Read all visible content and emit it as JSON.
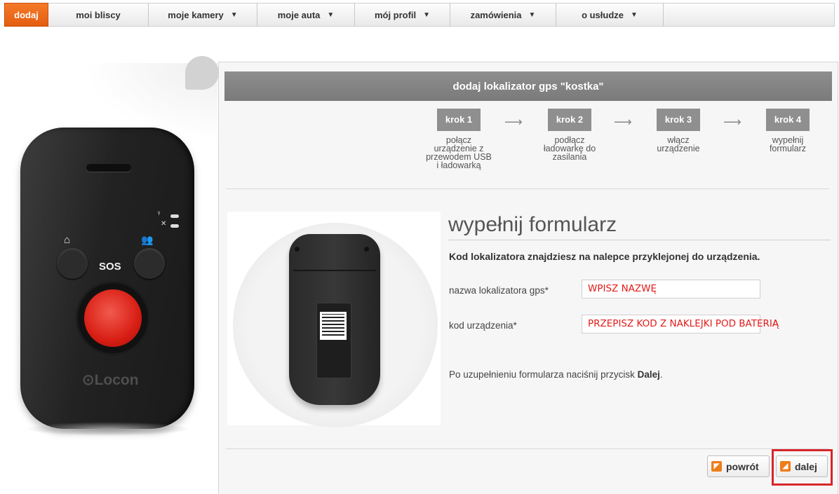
{
  "nav": {
    "items": [
      {
        "label": "dodaj",
        "active": true
      },
      {
        "label": "moi bliscy",
        "has_dropdown": false
      },
      {
        "label": "moje kamery",
        "has_dropdown": true
      },
      {
        "label": "moje auta",
        "has_dropdown": true
      },
      {
        "label": "mój profil",
        "has_dropdown": true
      },
      {
        "label": "zamówienia",
        "has_dropdown": true
      },
      {
        "label": "o usłudze",
        "has_dropdown": true
      }
    ],
    "active_color": "#ec6a1c"
  },
  "device": {
    "sos_label": "SOS",
    "brand": "⊙Locon",
    "button_color": "#d81e14"
  },
  "panel": {
    "title": "dodaj lokalizator gps \"kostka\"",
    "steps": [
      {
        "badge": "krok 1",
        "desc": [
          "połącz",
          "urządzenie z",
          "przewodem USB",
          "i ładowarką"
        ]
      },
      {
        "badge": "krok 2",
        "desc": [
          "podłącz",
          "ładowarkę do",
          "zasilania"
        ]
      },
      {
        "badge": "krok 3",
        "desc": [
          "włącz",
          "urządzenie"
        ]
      },
      {
        "badge": "krok 4",
        "desc": [
          "wypełnij",
          "formularz"
        ]
      }
    ]
  },
  "form": {
    "title": "wypełnij formularz",
    "info": "Kod lokalizatora znajdziesz na nalepce przyklejonej do urządzenia.",
    "name_label": "nazwa lokalizatora gps*",
    "name_value": "WPISZ NAZWĘ",
    "code_label": "kod urządzenia*",
    "code_value": "PRZEPISZ KOD Z NAKLEJKI POD BATERIĄ",
    "hint_prefix": "Po uzupełnieniu formularza naciśnij przycisk ",
    "hint_bold": "Dalej",
    "hint_suffix": ".",
    "input_text_color": "#e31a1a"
  },
  "buttons": {
    "back_label": "powrót",
    "next_label": "dalej",
    "icon_color": "#ef7d1a",
    "highlight_color": "#d7262a"
  }
}
